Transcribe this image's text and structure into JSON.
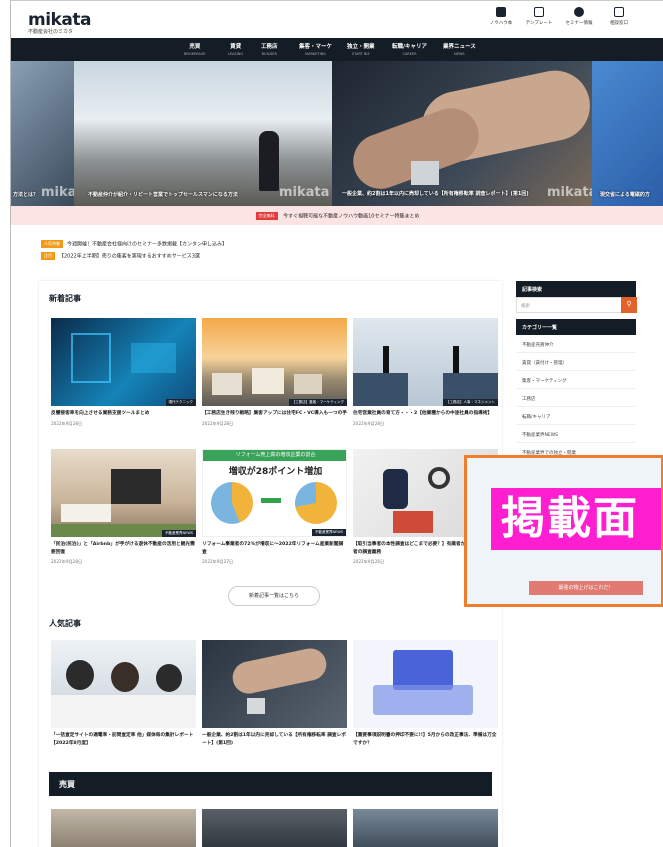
{
  "header": {
    "logo": "mikata",
    "logo_sub": "不動産会社のミカタ",
    "util_links": [
      {
        "label": "ノウハウ本",
        "icon": "book-icon"
      },
      {
        "label": "テンプレート",
        "icon": "document-icon"
      },
      {
        "label": "セミナー情報",
        "icon": "people-icon"
      },
      {
        "label": "相談窓口",
        "icon": "monitor-icon"
      }
    ]
  },
  "nav": [
    {
      "label": "売買",
      "sub": "BROKERAGE"
    },
    {
      "label": "賃貸",
      "sub": "LEASING"
    },
    {
      "label": "工務店",
      "sub": "BUILDER"
    },
    {
      "label": "集客・マーケ",
      "sub": "MARKETING"
    },
    {
      "label": "独立・開業",
      "sub": "START BIZ"
    },
    {
      "label": "転職/キャリア",
      "sub": "CAREER"
    },
    {
      "label": "業界ニュース",
      "sub": "NEWS"
    }
  ],
  "hero": {
    "captions": [
      "方法とは？",
      "不動産仲介が紹介・リピート営業でトップセールスマンになる方法",
      "一般企業、約2割は1年以内に売却している【所有権移転率 調査レポート】(第1回)",
      "現交省による電磁的方"
    ],
    "watermark": "mikata"
  },
  "notice": {
    "tag": "完全無料",
    "text": "今すぐ視聴可能な不動産ノウハウ動画10セミナー特集まとめ"
  },
  "news": [
    {
      "tag": "人気特集",
      "text": "今週開催！不動産会社様向けのセミナー多数掲載【カンタン申し込み】"
    },
    {
      "tag": "注目",
      "text": "【2022年上半期】売りの集客を実現するおすすめサービス3選"
    }
  ],
  "new_articles": {
    "title": "新着記事",
    "items": [
      {
        "title": "反響接客率を向上させる業務支援ツールまとめ",
        "date": "2022年9月28日",
        "badge": "現代テクニック"
      },
      {
        "title": "【工務店生き残り戦略】集客アップには住宅FC・VC導入も一つの手",
        "date": "2022年9月28日",
        "badge": "【工務店】集客・マーケティング"
      },
      {
        "title": "住宅営業社員の育て方・・・2【他業種からの中途社員の指導術】",
        "date": "2022年9月28日",
        "badge": "【工務店】人事・マネジメント"
      },
      {
        "title": "「民泊(民泊)」と「Airbnb」が手がける遊休不動産の活用と観光需要回復",
        "date": "2022年9月28日",
        "badge": "不動産業界NEWS"
      },
      {
        "title": "リフォーム事業者の72%が増収に〜2022年リフォーム産業新聞調査",
        "date": "2022年9月27日",
        "badge": "不動産業界NEWS"
      },
      {
        "title": "【取引当事者の本性調査はどこまで必要？】有識者から見る宅建業者の調査義務",
        "date": "2022年9月26日",
        "badge": "不動産業界NEWS"
      }
    ],
    "chart_headline": "リフォーム売上高の増収企業の割合",
    "chart_big": "増収が28ポイント増加",
    "more_label": "新着記事一覧はこちら"
  },
  "popular": {
    "title": "人気記事",
    "items": [
      {
        "title": "「一括査定サイトの適電率・訪問査定率 他」媒体毎の集計レポート【2022年8月度】"
      },
      {
        "title": "一般企業、約2割は1年以内に売却している【所有権移転率 調査レポート】(第1回)"
      },
      {
        "title": "【重要事項説明書の押印不要に!!】5月からの改正事法、準備は万全ですか？"
      }
    ]
  },
  "category_bar": "売買",
  "sidebar": {
    "search_title": "記事検索",
    "search_placeholder": "検索",
    "category_title": "カテゴリー一覧",
    "categories": [
      "不動産売買仲介",
      "賃貸（賃付け・管理）",
      "集客・マーケティング",
      "工務店",
      "転職/キャリア",
      "不動産業界NEWS",
      "不動産業界での独立・開業"
    ]
  },
  "ad": {
    "text": "掲載面",
    "bottom": "最強の物上げはこれだ！",
    "accent": "#ff1fd0",
    "border": "#ee7d2f"
  }
}
